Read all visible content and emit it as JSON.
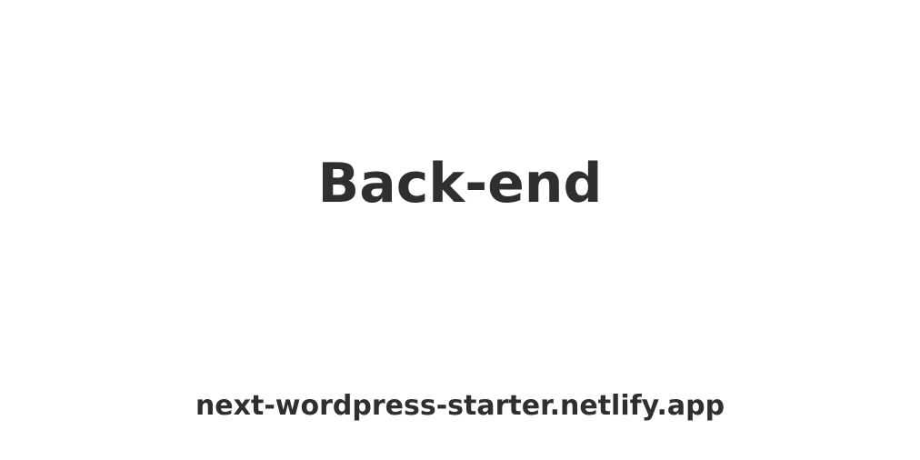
{
  "card": {
    "title": "Back-end",
    "site_url": "next-wordpress-starter.netlify.app"
  },
  "colors": {
    "background": "#ffffff",
    "text": "#2f2f2f"
  }
}
